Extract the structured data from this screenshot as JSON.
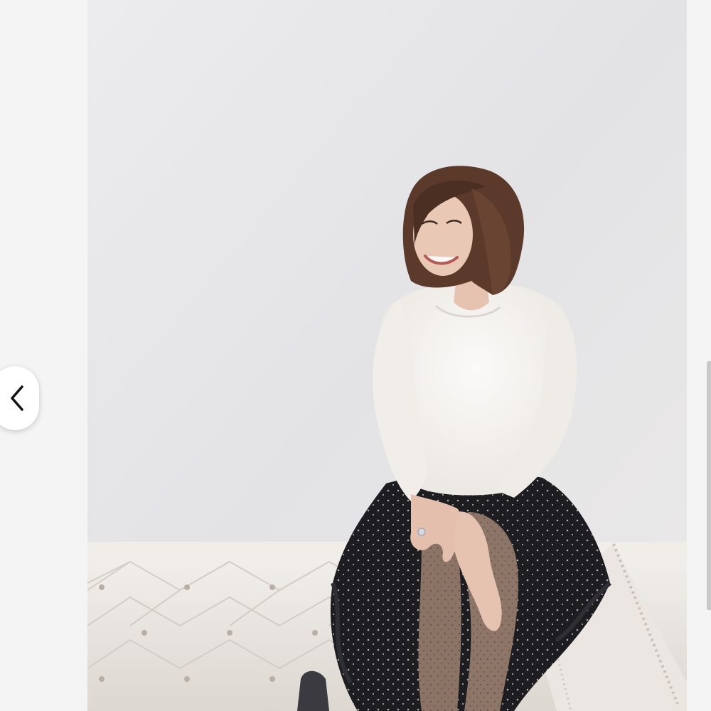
{
  "viewer": {
    "photo": {
      "subject": "woman-seated-on-tufted-bench",
      "colors": {
        "wall": "#e6e6e8",
        "sweater": "#f7f5f2",
        "skirt": "#1b1b1f",
        "bench": "#eae6e2",
        "hair": "#5a3a2c",
        "skin": "#e8c4b2"
      }
    },
    "navigation": {
      "prev_icon": "chevron-left-icon"
    },
    "scrollbar": {
      "color": "#c8c8c8"
    }
  }
}
